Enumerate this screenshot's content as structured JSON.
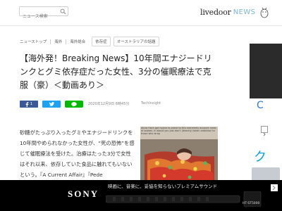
{
  "header": {
    "search_placeholder": "ニュース検索",
    "logo_text": "livedoor",
    "logo_news": "NEWS",
    "icons": {
      "search": "search-icon",
      "mascot": "mascot-icon"
    }
  },
  "breadcrumb": {
    "items": [
      "ニューストップ",
      "海外",
      "海外総合"
    ],
    "tags": [
      "依存症",
      "オーストラリアの話題"
    ]
  },
  "article": {
    "title": "【海外発！Breaking News】10年間エナジードリンクとグミ依存症だった女性、3分の催眠療法で克服（豪）＜動画あり＞",
    "share": {
      "facebook_count": "1",
      "facebook_icon": "facebook-icon",
      "twitter_icon": "twitter-icon",
      "line_icon": "line-icon"
    },
    "date": "2020年12月9日 6時45分",
    "author": "TechInsight",
    "body": "砂糖がたっぷり入ったグミやエナジードリンクを10年間やめられなかった女性が、“死の恐怖”を感じて催眠療法を受けた。治療はたった3分で女性はそれ以来、依存していた食品に触れてもいないという。『A Current Affair』『Pede",
    "image_caption": "Alicia Hoch got hypno to prove to this extremely account news of snakes. In about you just don't (directly) taken addiction to those who wrap"
  },
  "right_ad": {
    "letter_c": "C",
    "letter_k": "ク",
    "arrow_icon": "arrow-icon"
  },
  "bottom_ad": {
    "brand": "SONY",
    "tagline": "映画に、音楽に、妥協を知らないプレミアムサウンド",
    "model": "HT-ST5000",
    "close_icon": "ad-close-icon"
  },
  "colors": {
    "facebook": "#3b5998",
    "twitter": "#1da1f2",
    "line": "#00b900",
    "logo_news": "#7ab8d8"
  }
}
